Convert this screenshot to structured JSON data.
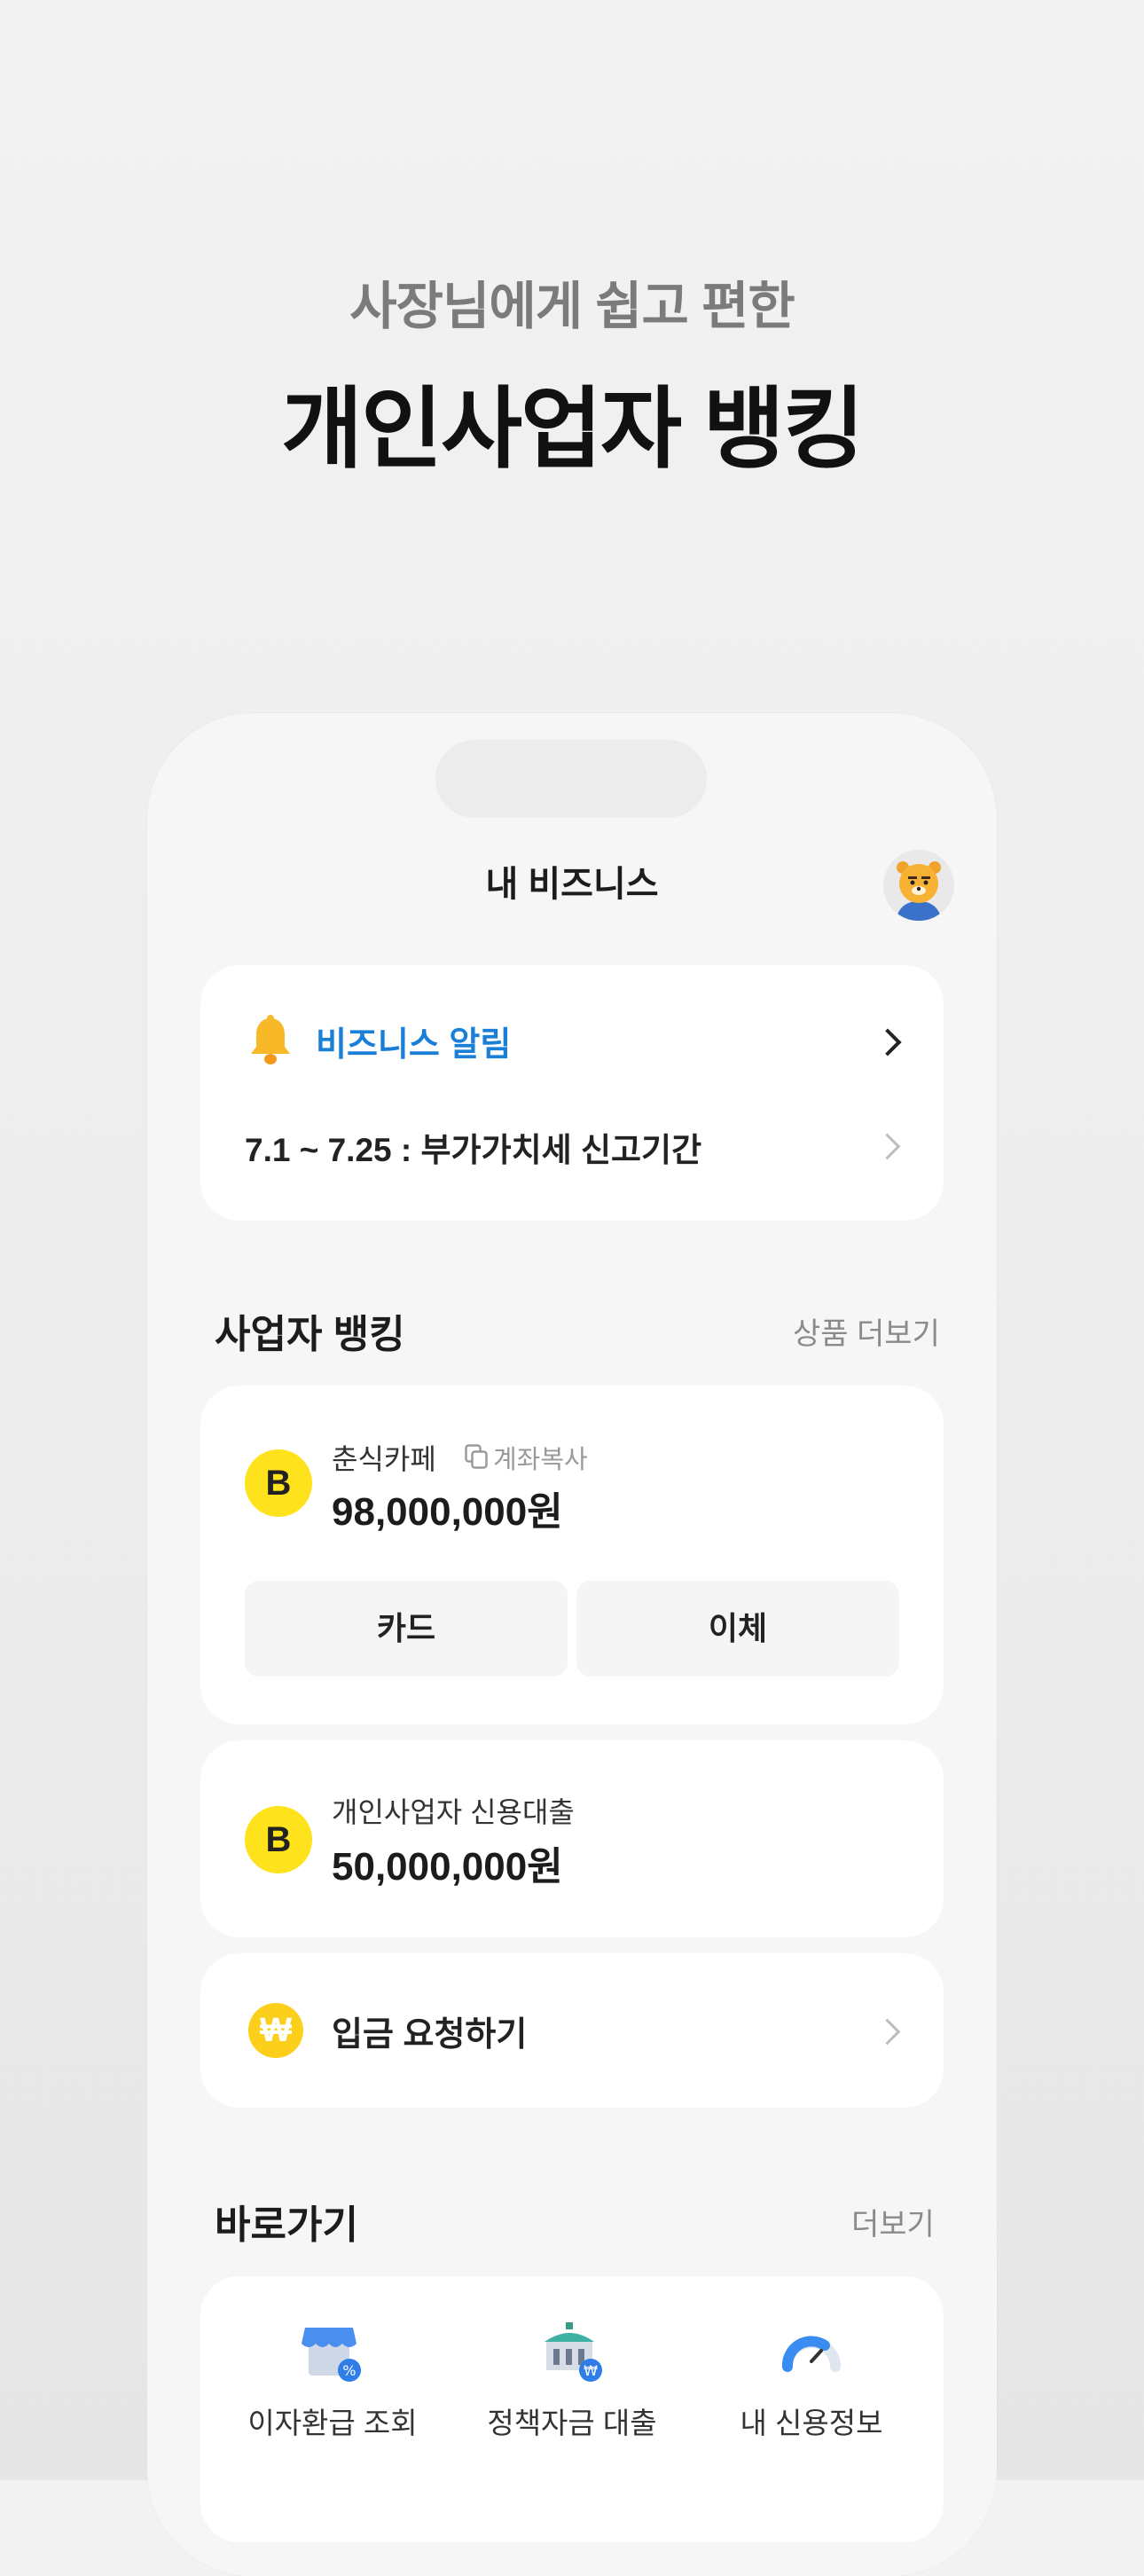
{
  "hero": {
    "subtitle": "사장님에게 쉽고 편한",
    "title": "개인사업자 뱅킹"
  },
  "header": {
    "title": "내 비즈니스"
  },
  "notice": {
    "label": "비즈니스 알림",
    "item": "7.1 ~ 7.25 : 부가가치세 신고기간"
  },
  "banking": {
    "title": "사업자 뱅킹",
    "more": "상품 더보기",
    "account": {
      "name": "춘식카페",
      "copy_label": "계좌복사",
      "balance": "98,000,000원",
      "card_button": "카드",
      "transfer_button": "이체"
    },
    "loan": {
      "name": "개인사업자 신용대출",
      "amount": "50,000,000원"
    },
    "deposit_request": "입금 요청하기"
  },
  "shortcuts": {
    "title": "바로가기",
    "more": "더보기",
    "items": [
      {
        "label": "이자환급 조회",
        "icon": "store-discount-icon"
      },
      {
        "label": "정책자금 대출",
        "icon": "bank-building-icon"
      },
      {
        "label": "내 신용정보",
        "icon": "credit-gauge-icon"
      }
    ]
  },
  "colors": {
    "accent": "#1a7fd6",
    "brand_yellow": "#fde21c"
  }
}
